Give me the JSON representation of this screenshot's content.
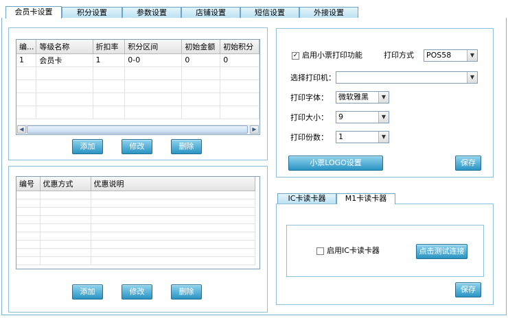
{
  "tabs": [
    {
      "label": "会员卡设置",
      "active": true
    },
    {
      "label": "积分设置",
      "active": false
    },
    {
      "label": "参数设置",
      "active": false
    },
    {
      "label": "店铺设置",
      "active": false
    },
    {
      "label": "短信设置",
      "active": false
    },
    {
      "label": "外接设置",
      "active": false
    }
  ],
  "levels": {
    "columns": [
      "编...",
      "等级名称",
      "折扣率",
      "积分区间",
      "初始金额",
      "初始积分"
    ],
    "rows": [
      [
        "1",
        "会员卡",
        "1",
        "0-0",
        "0",
        "0"
      ]
    ],
    "buttons": {
      "add": "添加",
      "edit": "修改",
      "delete": "删除"
    }
  },
  "discounts": {
    "columns": [
      "编号",
      "优惠方式",
      "优惠说明"
    ],
    "rows": [],
    "buttons": {
      "add": "添加",
      "edit": "修改",
      "delete": "删除"
    }
  },
  "printer": {
    "enable_label": "启用小票打印功能",
    "enable_checked": true,
    "method_label": "打印方式",
    "method_value": "POS58",
    "printer_label": "选择打印机：",
    "printer_value": "",
    "font_label": "打印字体：",
    "font_value": "微软雅黑",
    "size_label": "打印大小：",
    "size_value": "9",
    "copies_label": "打印份数：",
    "copies_value": "1",
    "logo_button": "小票LOGO设置",
    "save_button": "保存"
  },
  "reader": {
    "tabs": [
      {
        "label": "IC卡读卡器",
        "active": false
      },
      {
        "label": "M1卡读卡器",
        "active": true
      }
    ],
    "enable_label": "启用IC卡读卡器",
    "enable_checked": false,
    "test_button": "点击测试连接",
    "save_button": "保存"
  },
  "colors": {
    "button_top": "#8fd3ee",
    "button_bottom": "#2b94c3",
    "tab_border": "#6aa5c9",
    "group_border": "#8ec0dd"
  }
}
